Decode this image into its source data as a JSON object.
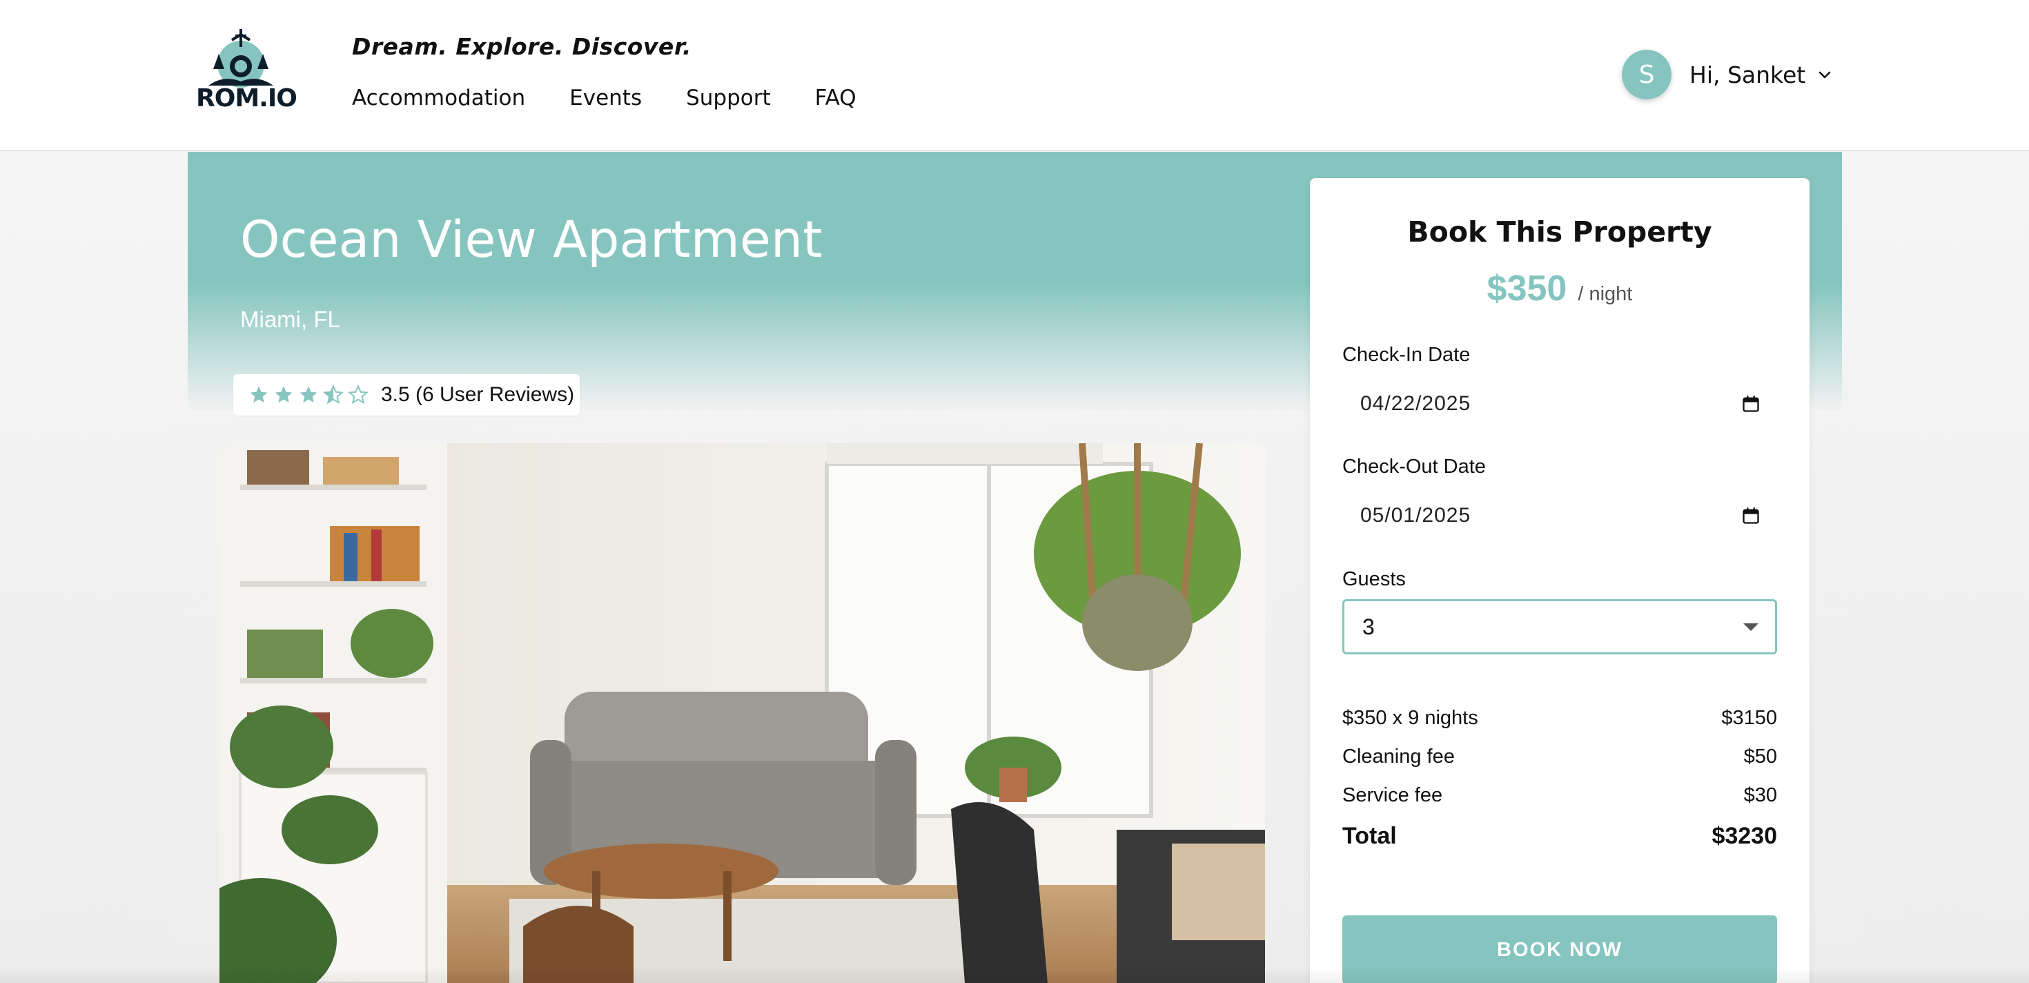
{
  "brand": {
    "logo_text": "ROM.IO",
    "tagline": "Dream. Explore. Discover."
  },
  "nav": {
    "items": [
      {
        "label": "Accommodation"
      },
      {
        "label": "Events"
      },
      {
        "label": "Support"
      },
      {
        "label": "FAQ"
      }
    ]
  },
  "user": {
    "initial": "S",
    "greeting": "Hi, Sanket",
    "menu_icon": "chevron-down-icon"
  },
  "property": {
    "title": "Ocean View Apartment",
    "location": "Miami, FL",
    "rating_value": 3.5,
    "rating_max": 5,
    "rating_text": "3.5 (6 User Reviews)",
    "photo_icon": "living-room-photo"
  },
  "booking": {
    "title": "Book This Property",
    "price": "$350",
    "per": "/ night",
    "check_in_label": "Check-In Date",
    "check_in_value": "04/22/2025",
    "check_out_label": "Check-Out Date",
    "check_out_value": "05/01/2025",
    "guests_label": "Guests",
    "guests_value": "3",
    "lines": [
      {
        "label": "$350 x 9 nights",
        "amount": "$3150"
      },
      {
        "label": "Cleaning fee",
        "amount": "$50"
      },
      {
        "label": "Service fee",
        "amount": "$30"
      }
    ],
    "total_label": "Total",
    "total_amount": "$3230",
    "button_label": "BOOK NOW"
  },
  "colors": {
    "accent": "#86c5bf",
    "text": "#111111",
    "header_bg": "#ffffff"
  }
}
